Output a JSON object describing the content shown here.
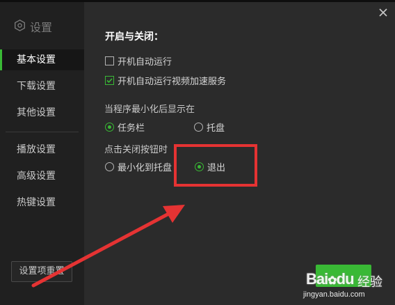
{
  "sidebar": {
    "logo_text": "设置",
    "items": [
      {
        "label": "基本设置",
        "active": true
      },
      {
        "label": "下载设置",
        "active": false
      },
      {
        "label": "其他设置",
        "active": false
      },
      {
        "label": "播放设置",
        "active": false
      },
      {
        "label": "高级设置",
        "active": false
      },
      {
        "label": "热键设置",
        "active": false
      }
    ],
    "reset_label": "设置项重置"
  },
  "main": {
    "section_title": "开启与关闭：",
    "checkboxes": [
      {
        "label": "开机自动运行",
        "checked": false
      },
      {
        "label": "开机自动运行视频加速服务",
        "checked": true
      }
    ],
    "minimize_group": {
      "heading": "当程序最小化后显示在",
      "options": [
        {
          "label": "任务栏",
          "selected": true
        },
        {
          "label": "托盘",
          "selected": false
        }
      ]
    },
    "close_group": {
      "heading": "点击关闭按钮时",
      "options": [
        {
          "label": "最小化到托盘",
          "selected": false
        },
        {
          "label": "退出",
          "selected": true
        }
      ]
    }
  },
  "watermark": {
    "logo": "Bai",
    "logo_paw": "du",
    "jingyan": "经验",
    "url": "jingyan.baidu.com"
  },
  "colors": {
    "accent": "#39b935",
    "annotation": "#e53333",
    "background": "#2b2b2b",
    "sidebar": "#202020"
  }
}
